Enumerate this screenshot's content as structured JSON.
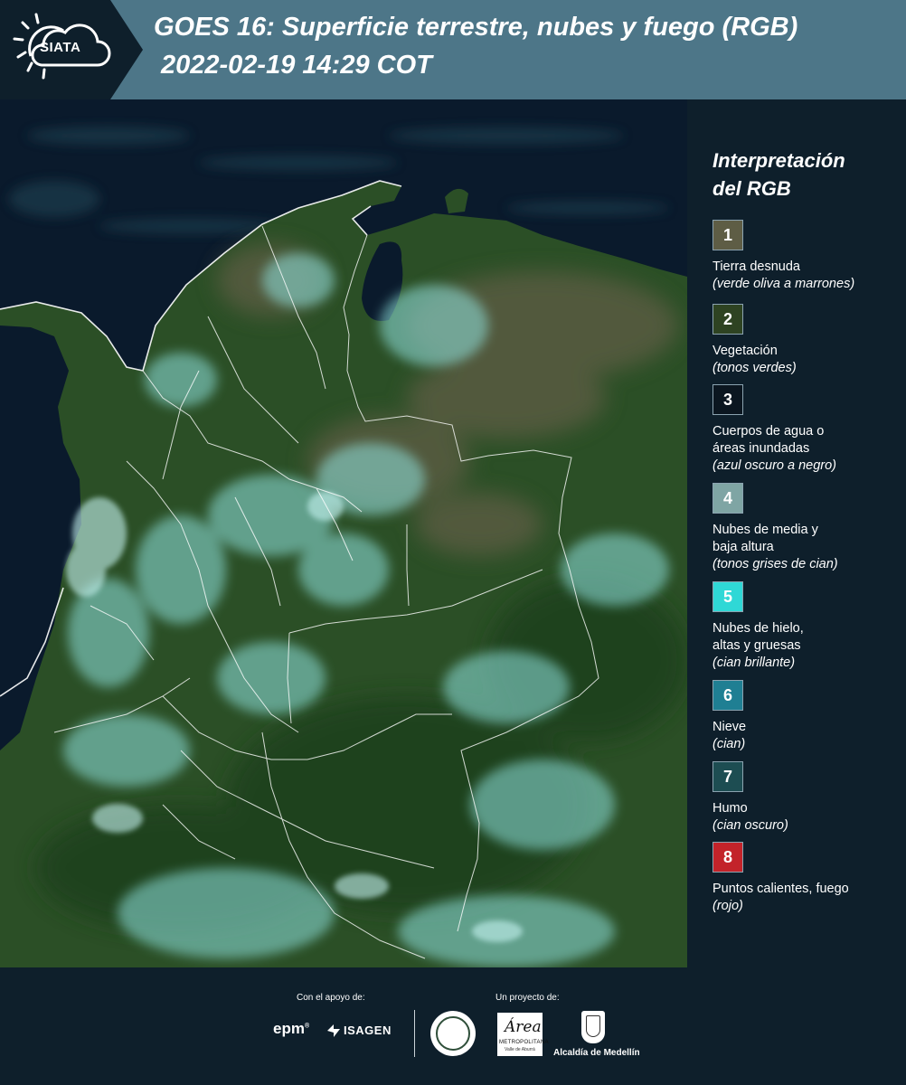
{
  "header": {
    "logo_text": "SIATA",
    "title_line1": "GOES 16: Superficie terrestre, nubes y fuego (RGB)",
    "title_line2": "2022-02-19 14:29 COT",
    "background_color": "#4d7688"
  },
  "legend": {
    "title_line1": "Interpretación",
    "title_line2": "del RGB",
    "items": [
      {
        "number": "1",
        "color": "#5e5d45",
        "label_lines": [
          "Tierra desnuda"
        ],
        "description": "(verde oliva a marrones)"
      },
      {
        "number": "2",
        "color": "#2e4322",
        "label_lines": [
          "Vegetación"
        ],
        "description": "(tonos verdes)"
      },
      {
        "number": "3",
        "color": "#0b1620",
        "label_lines": [
          "Cuerpos de agua o",
          "áreas inundadas"
        ],
        "description": "(azul oscuro a negro)"
      },
      {
        "number": "4",
        "color": "#7fa5a4",
        "label_lines": [
          "Nubes de media y",
          "baja altura"
        ],
        "description": "(tonos grises de cian)"
      },
      {
        "number": "5",
        "color": "#2fd8d6",
        "label_lines": [
          "Nubes de hielo,",
          "altas y gruesas"
        ],
        "description": "(cian brillante)"
      },
      {
        "number": "6",
        "color": "#1f7f93",
        "label_lines": [
          "Nieve"
        ],
        "description": "(cian)"
      },
      {
        "number": "7",
        "color": "#1d4d52",
        "label_lines": [
          "Humo"
        ],
        "description": "(cian oscuro)"
      },
      {
        "number": "8",
        "color": "#c3232a",
        "label_lines": [
          "Puntos calientes, fuego"
        ],
        "description": "(rojo)"
      }
    ]
  },
  "footer": {
    "support_label": "Con el apoyo de:",
    "project_label": "Un proyecto de:",
    "epm_text": "epm",
    "isagen_text": "ISAGEN",
    "area_script": "Área",
    "area_metro": "METROPOLITANA",
    "area_valle": "Valle de Aburrá",
    "medellin_text": "Alcaldía de Medellín"
  },
  "map": {
    "icon": "satellite-rgb-map",
    "colors": {
      "ocean": "#0a1a2c",
      "vegetation": "#2b4f26",
      "bare_land": "#5e5d45",
      "cloud": "#8fe3e0",
      "border": "#ffffff"
    }
  }
}
